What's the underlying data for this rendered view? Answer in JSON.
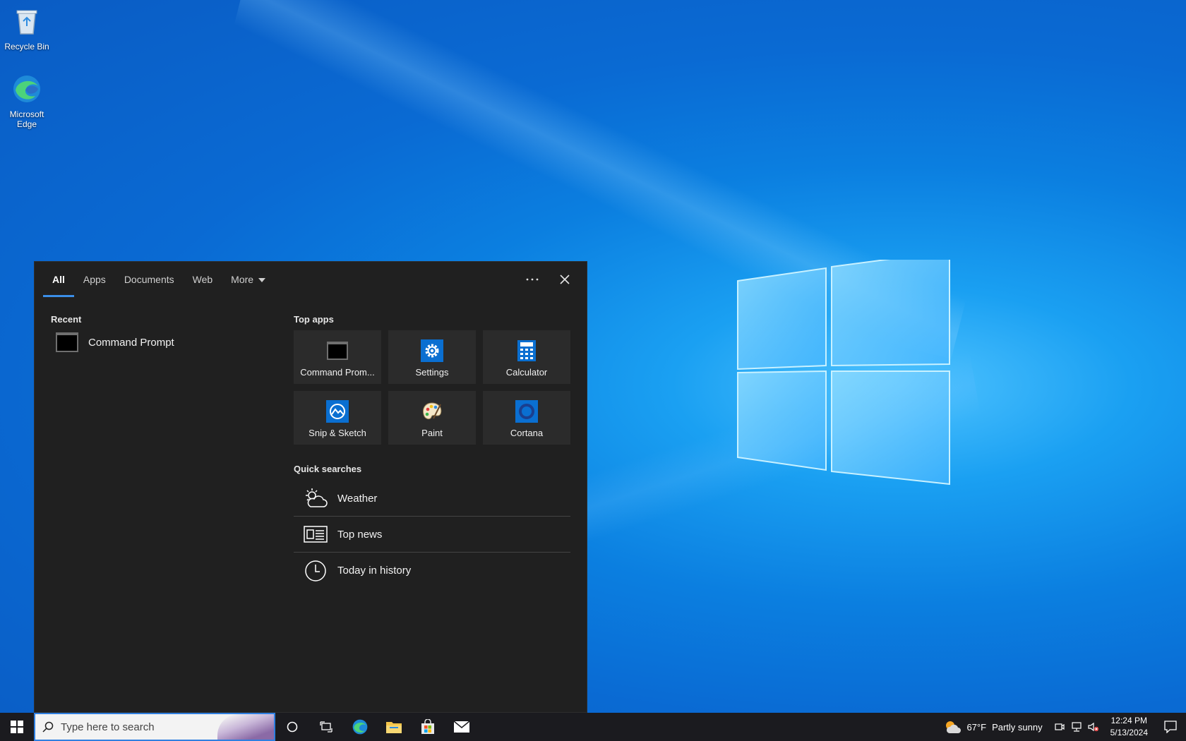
{
  "desktop": {
    "icons": [
      {
        "label": "Recycle Bin",
        "icon": "recycle-bin-icon"
      },
      {
        "label": "Microsoft Edge",
        "icon": "edge-icon"
      }
    ]
  },
  "search_panel": {
    "tabs": [
      {
        "label": "All",
        "active": true
      },
      {
        "label": "Apps"
      },
      {
        "label": "Documents"
      },
      {
        "label": "Web"
      },
      {
        "label": "More"
      }
    ],
    "recent_label": "Recent",
    "recent_items": [
      {
        "label": "Command Prompt",
        "icon": "command-prompt-icon"
      }
    ],
    "top_apps_label": "Top apps",
    "top_apps": [
      {
        "label": "Command Prom...",
        "icon": "command-prompt-icon"
      },
      {
        "label": "Settings",
        "icon": "gear-icon"
      },
      {
        "label": "Calculator",
        "icon": "calculator-icon"
      },
      {
        "label": "Snip & Sketch",
        "icon": "snip-sketch-icon"
      },
      {
        "label": "Paint",
        "icon": "paint-palette-icon"
      },
      {
        "label": "Cortana",
        "icon": "cortana-icon"
      }
    ],
    "quick_searches_label": "Quick searches",
    "quick_searches": [
      {
        "label": "Weather",
        "icon": "weather-cloud-sun-icon"
      },
      {
        "label": "Top news",
        "icon": "newspaper-icon"
      },
      {
        "label": "Today in history",
        "icon": "clock-icon"
      }
    ]
  },
  "taskbar": {
    "search_placeholder": "Type here to search",
    "pinned": [
      "cortana-circle-icon",
      "task-view-icon",
      "edge-icon",
      "file-explorer-icon",
      "microsoft-store-icon",
      "mail-icon"
    ],
    "weather": {
      "temp": "67°F",
      "condition": "Partly sunny"
    },
    "clock": {
      "time": "12:24 PM",
      "date": "5/13/2024"
    }
  },
  "colors": {
    "accent": "#3b8ee8",
    "panel_bg": "#202020",
    "tile_bg": "#2b2b2b",
    "taskbar_bg": "#1b1b1f"
  }
}
